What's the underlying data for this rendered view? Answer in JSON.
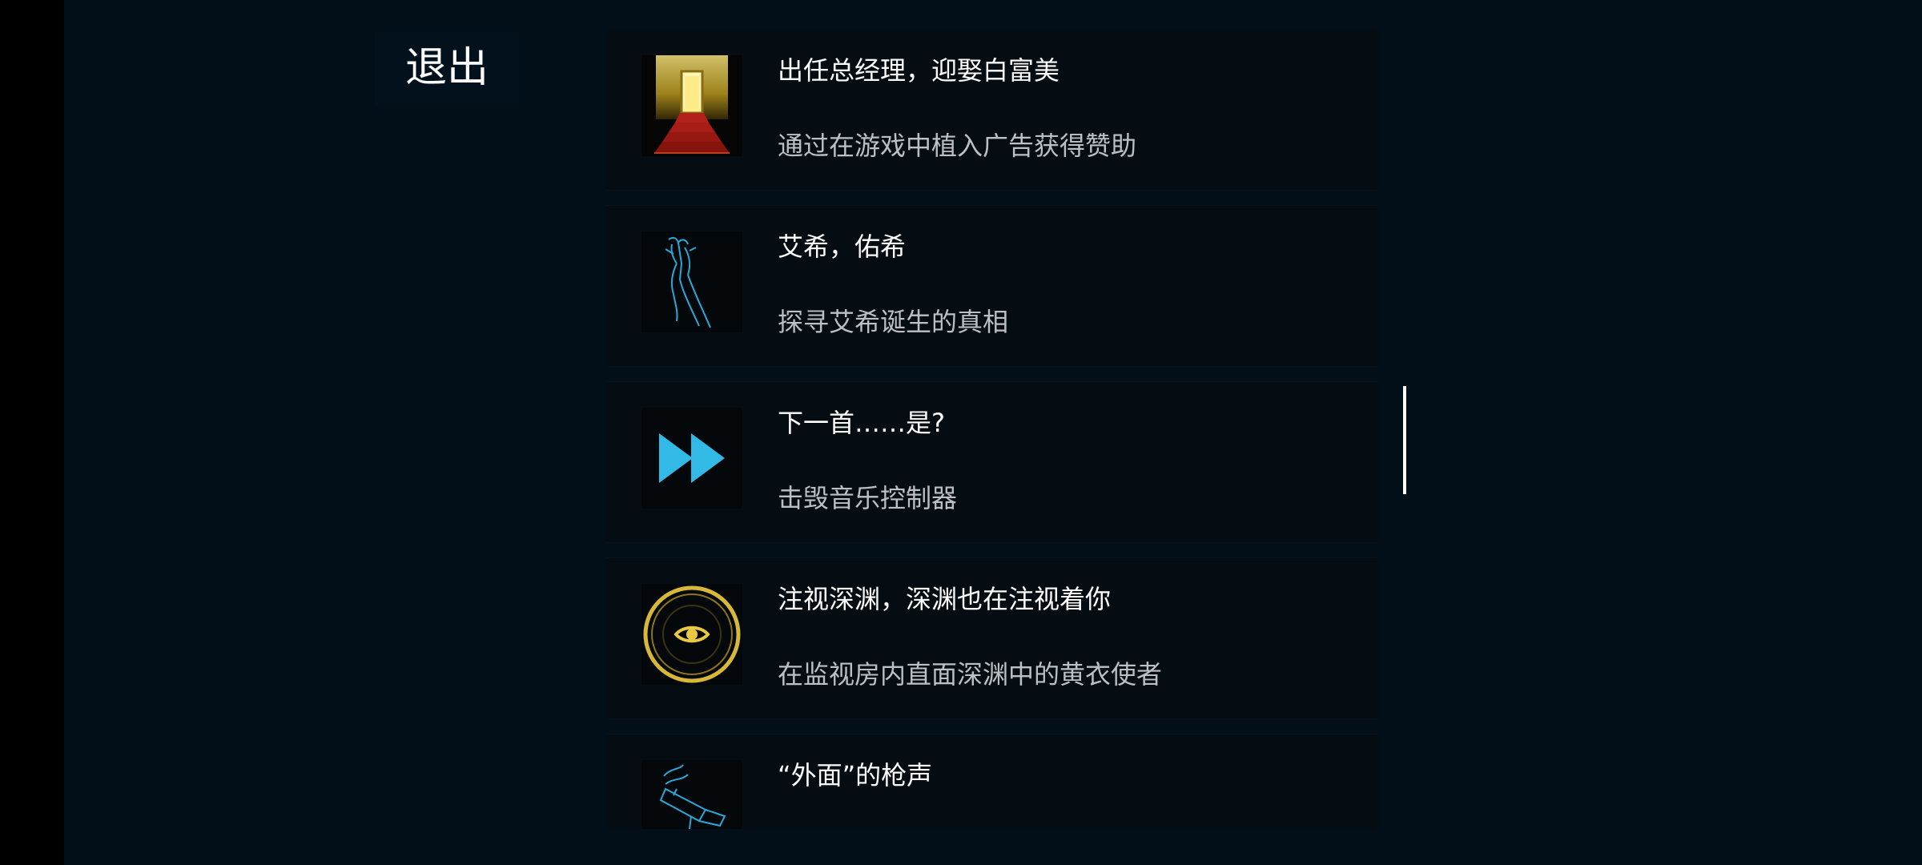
{
  "exit_button": {
    "label": "退出"
  },
  "achievements": [
    {
      "title": "出任总经理，迎娶白富美",
      "description": "通过在游戏中植入广告获得赞助",
      "icon": "golden-stairway-door-icon"
    },
    {
      "title": "艾希，佑希",
      "description": "探寻艾希诞生的真相",
      "icon": "blue-figure-sketch-icon"
    },
    {
      "title": "下一首……是?",
      "description": "击毁音乐控制器",
      "icon": "fast-forward-icon"
    },
    {
      "title": "注视深渊，深渊也在注视着你",
      "description": "在监视房内直面深渊中的黄衣使者",
      "icon": "golden-eye-circle-icon"
    },
    {
      "title": "“外面”的枪声",
      "description": "",
      "icon": "blue-gun-sketch-icon"
    }
  ],
  "colors": {
    "background": "#020e18",
    "card_background": "#060d12",
    "title_text": "#ffffff",
    "description_text": "#bcc0c4",
    "accent_blue": "#2aa8d8",
    "accent_gold": "#d8b83a"
  }
}
